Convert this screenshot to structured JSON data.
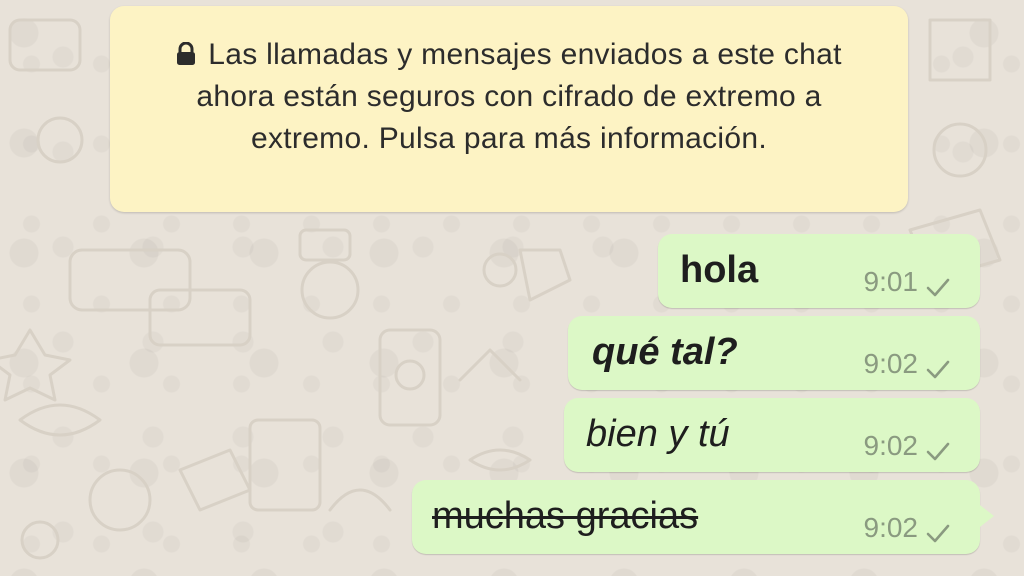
{
  "chat": {
    "encryption_notice": "Las llamadas y mensajes enviados a este chat ahora están seguros con cifrado de extremo a extremo. Pulsa para más información.",
    "messages": [
      {
        "text": "hola",
        "time": "9:01",
        "status_icon": "check-icon",
        "style": "bold"
      },
      {
        "text": "qué tal?",
        "time": "9:02",
        "status_icon": "check-icon",
        "style": "bold-italic"
      },
      {
        "text": "bien y tú",
        "time": "9:02",
        "status_icon": "check-icon",
        "style": "italic"
      },
      {
        "text": "muchas gracias",
        "time": "9:02",
        "status_icon": "check-icon",
        "style": "strikethrough"
      }
    ]
  },
  "colors": {
    "background": "#e8e2d9",
    "notice_background": "#fdf3c4",
    "outgoing_bubble": "#dcf8c6",
    "meta_text": "#8a9a80"
  }
}
